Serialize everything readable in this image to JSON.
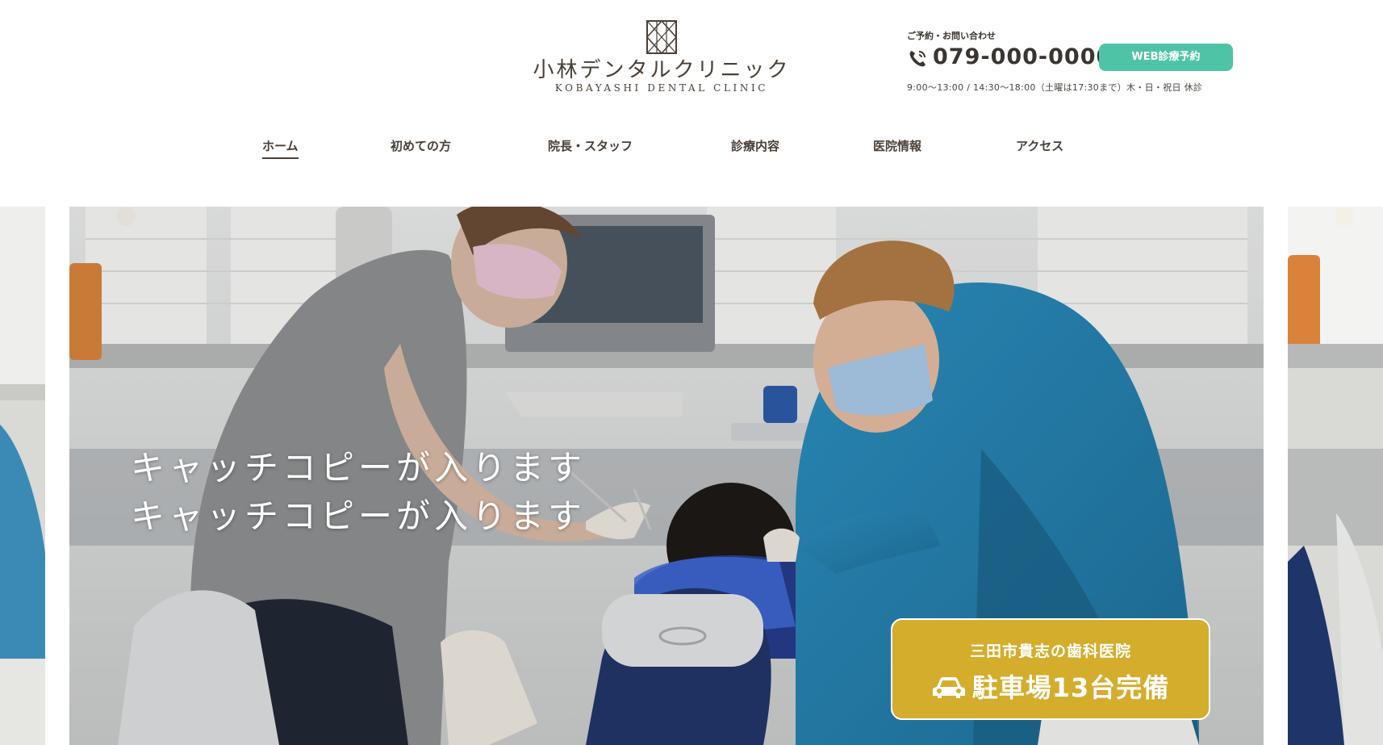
{
  "header": {
    "logo_ja": "小林デンタルクリニック",
    "logo_en": "KOBAYASHI DENTAL CLINIC",
    "contact_label": "ご予約・お問い合わせ",
    "tel": "079-000-0000",
    "web_button": "WEB診療予約",
    "hours": "9:00〜13:00 / 14:30〜18:00（土曜は17:30まで）木・日・祝日 休診"
  },
  "nav": {
    "items": [
      {
        "label": "ホーム",
        "active": true
      },
      {
        "label": "初めての方"
      },
      {
        "label": "院長・スタッフ"
      },
      {
        "label": "診療内容"
      },
      {
        "label": "医院情報"
      },
      {
        "label": "アクセス"
      }
    ]
  },
  "hero": {
    "catch_line1": "キャッチコピーが入ります",
    "catch_line2": "キャッチコピーが入ります"
  },
  "parking": {
    "sub": "三田市貴志の歯科医院",
    "main": "駐車場13台完備"
  },
  "colors": {
    "accent_green": "#4fc3a5",
    "parking_gold": "#d4ad2c",
    "text_brown": "#4a4038"
  },
  "icons": [
    "logo-mark-icon",
    "phone-icon",
    "car-icon"
  ]
}
